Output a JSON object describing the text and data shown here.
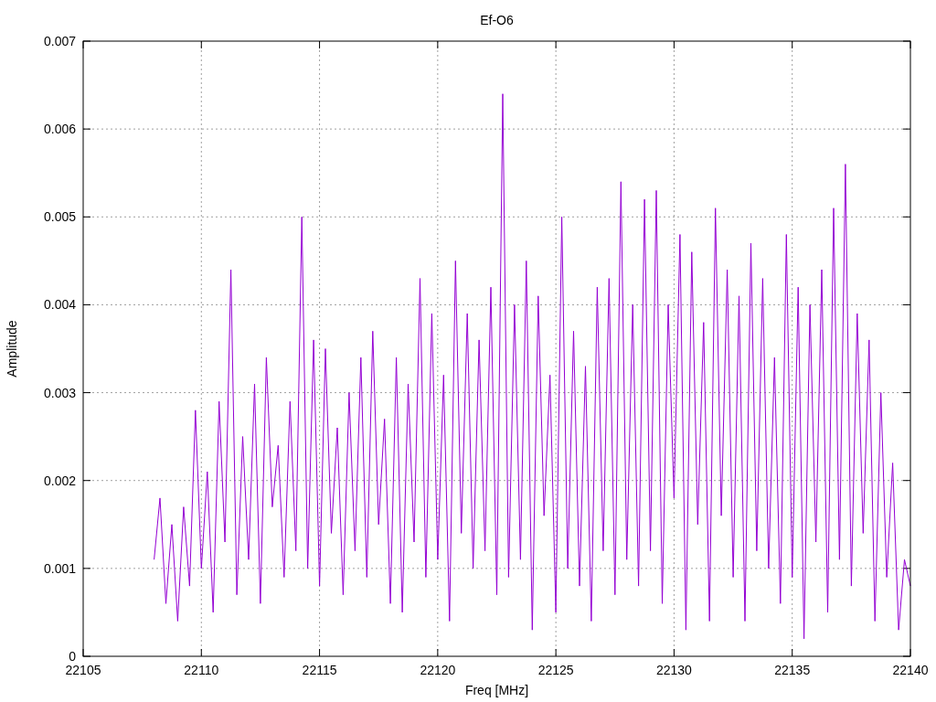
{
  "chart_data": {
    "type": "line",
    "title": "Ef-O6",
    "xlabel": "Freq [MHz]",
    "ylabel": "Amplitude",
    "x": [
      22108,
      22108.25,
      22108.5,
      22108.75,
      22109,
      22109.25,
      22109.5,
      22109.75,
      22110,
      22110.25,
      22110.5,
      22110.75,
      22111,
      22111.25,
      22111.5,
      22111.75,
      22112,
      22112.25,
      22112.5,
      22112.75,
      22113,
      22113.25,
      22113.5,
      22113.75,
      22114,
      22114.25,
      22114.5,
      22114.75,
      22115,
      22115.25,
      22115.5,
      22115.75,
      22116,
      22116.25,
      22116.5,
      22116.75,
      22117,
      22117.25,
      22117.5,
      22117.75,
      22118,
      22118.25,
      22118.5,
      22118.75,
      22119,
      22119.25,
      22119.5,
      22119.75,
      22120,
      22120.25,
      22120.5,
      22120.75,
      22121,
      22121.25,
      22121.5,
      22121.75,
      22122,
      22122.25,
      22122.5,
      22122.75,
      22123,
      22123.25,
      22123.5,
      22123.75,
      22124,
      22124.25,
      22124.5,
      22124.75,
      22125,
      22125.25,
      22125.5,
      22125.75,
      22126,
      22126.25,
      22126.5,
      22126.75,
      22127,
      22127.25,
      22127.5,
      22127.75,
      22128,
      22128.25,
      22128.5,
      22128.75,
      22129,
      22129.25,
      22129.5,
      22129.75,
      22130,
      22130.25,
      22130.5,
      22130.75,
      22131,
      22131.25,
      22131.5,
      22131.75,
      22132,
      22132.25,
      22132.5,
      22132.75,
      22133,
      22133.25,
      22133.5,
      22133.75,
      22134,
      22134.25,
      22134.5,
      22134.75,
      22135,
      22135.25,
      22135.5,
      22135.75,
      22136,
      22136.25,
      22136.5,
      22136.75,
      22137,
      22137.25,
      22137.5,
      22137.75,
      22138,
      22138.25,
      22138.5,
      22138.75,
      22139,
      22139.25,
      22139.5,
      22139.75,
      22140
    ],
    "series": [
      {
        "color": "#9400d3",
        "values": [
          0.0011,
          0.0018,
          0.0006,
          0.0015,
          0.0004,
          0.0017,
          0.0008,
          0.0028,
          0.001,
          0.0021,
          0.0005,
          0.0029,
          0.0013,
          0.0044,
          0.0007,
          0.0025,
          0.0011,
          0.0031,
          0.0006,
          0.0034,
          0.0017,
          0.0024,
          0.0009,
          0.0029,
          0.0012,
          0.005,
          0.001,
          0.0036,
          0.0008,
          0.0035,
          0.0014,
          0.0026,
          0.0007,
          0.003,
          0.0012,
          0.0034,
          0.0009,
          0.0037,
          0.0015,
          0.0027,
          0.0006,
          0.0034,
          0.0005,
          0.0031,
          0.0013,
          0.0043,
          0.0009,
          0.0039,
          0.0011,
          0.0032,
          0.0004,
          0.0045,
          0.0014,
          0.0039,
          0.001,
          0.0036,
          0.0012,
          0.0042,
          0.0007,
          0.0064,
          0.0009,
          0.004,
          0.0011,
          0.0045,
          0.0003,
          0.0041,
          0.0016,
          0.0032,
          0.0005,
          0.005,
          0.001,
          0.0037,
          0.0008,
          0.0033,
          0.0004,
          0.0042,
          0.0012,
          0.0043,
          0.0007,
          0.0054,
          0.0011,
          0.004,
          0.0008,
          0.0052,
          0.0012,
          0.0053,
          0.0006,
          0.004,
          0.0018,
          0.0048,
          0.0003,
          0.0046,
          0.0015,
          0.0038,
          0.0004,
          0.0051,
          0.0016,
          0.0044,
          0.0009,
          0.0041,
          0.0004,
          0.0047,
          0.0012,
          0.0043,
          0.001,
          0.0034,
          0.0006,
          0.0048,
          0.0009,
          0.0042,
          0.0002,
          0.004,
          0.0013,
          0.0044,
          0.0005,
          0.0051,
          0.0011,
          0.0056,
          0.0008,
          0.0039,
          0.0014,
          0.0036,
          0.0004,
          0.003,
          0.0009,
          0.0022,
          0.0003,
          0.0011,
          0.0008
        ]
      }
    ],
    "xlim": [
      22105,
      22140
    ],
    "ylim": [
      0,
      0.007
    ],
    "xticks": [
      22105,
      22110,
      22115,
      22120,
      22125,
      22130,
      22135,
      22140
    ],
    "yticks": [
      0,
      0.001,
      0.002,
      0.003,
      0.004,
      0.005,
      0.006,
      0.007
    ],
    "grid": true
  }
}
